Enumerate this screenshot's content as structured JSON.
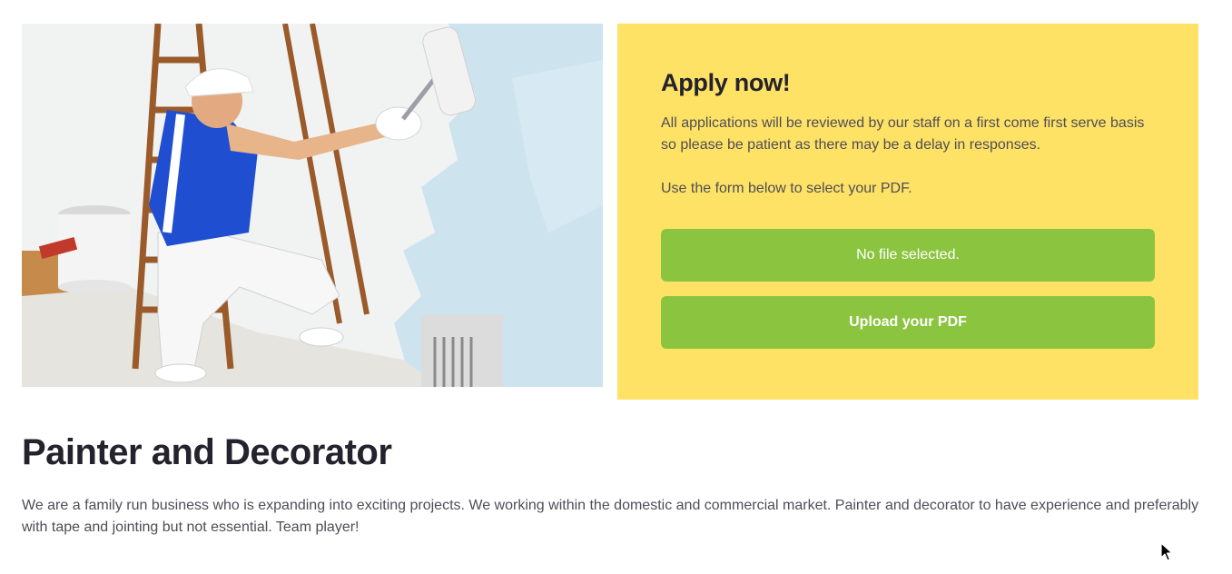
{
  "hero": {
    "image_description": "painter-and-decorator-photo"
  },
  "apply": {
    "title": "Apply now!",
    "paragraph_1": "All applications will be reviewed by our staff on a first come first serve basis so please be patient as there may be a delay in responses.",
    "paragraph_2": "Use the form below to select your PDF.",
    "file_status": "No file selected.",
    "upload_label": "Upload your PDF"
  },
  "job": {
    "title": "Painter and Decorator",
    "description": "We are a family run business who is expanding into exciting projects. We working within the domestic and commercial market. Painter and decorator to have experience and preferably with tape and jointing but not essential. Team player!"
  },
  "colors": {
    "panel_background": "#fee265",
    "button_green": "#8bc53f",
    "heading": "#24222c",
    "body_text": "#4f4d57"
  },
  "icons": {
    "cursor": "arrow-cursor-icon"
  }
}
